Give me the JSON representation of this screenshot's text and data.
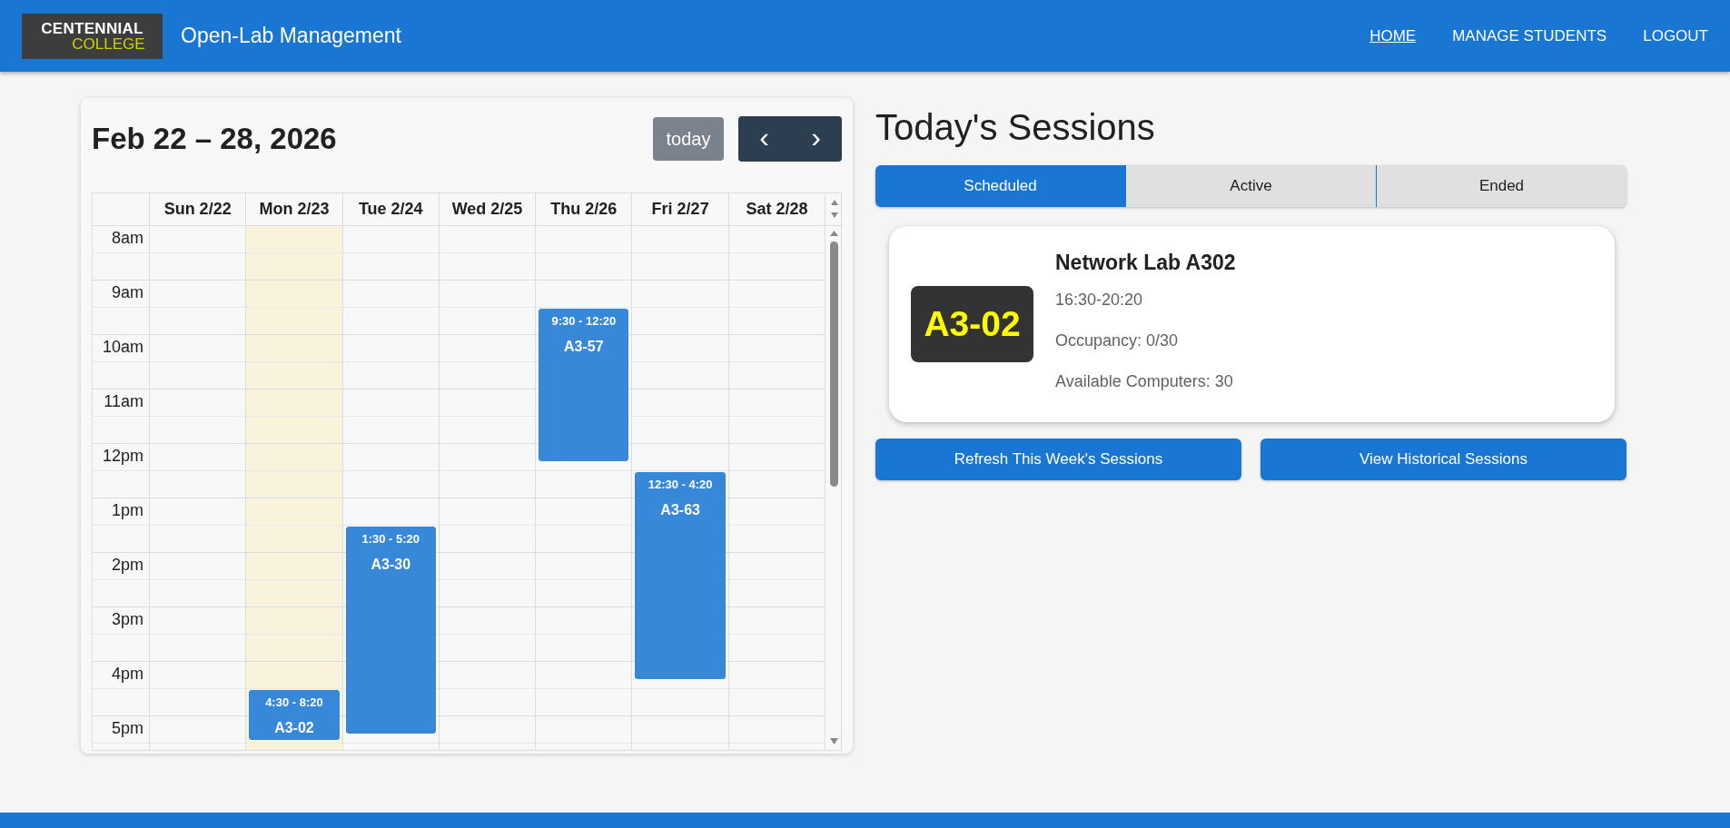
{
  "navbar": {
    "logo": [
      "CENTENNIAL",
      "COLLEGE"
    ],
    "title": "Open-Lab Management",
    "links": [
      {
        "label": "HOME",
        "selected": true
      },
      {
        "label": "MANAGE STUDENTS",
        "selected": false
      },
      {
        "label": "LOGOUT",
        "selected": false
      }
    ]
  },
  "calendar": {
    "title": "Feb 22 – 28, 2026",
    "today_button": "today",
    "prev_button": "‹",
    "next_button": "›",
    "days": [
      {
        "label": "Sun 2/22",
        "today": false
      },
      {
        "label": "Mon 2/23",
        "today": true,
        "events": [
          {
            "time": "4:30 - 8:20",
            "room": "A3-02"
          }
        ]
      },
      {
        "label": "Tue 2/24",
        "today": false,
        "events": [
          {
            "time": "1:30 - 5:20",
            "room": "A3-30"
          }
        ]
      },
      {
        "label": "Wed 2/25",
        "today": false
      },
      {
        "label": "Thu 2/26",
        "today": false,
        "events": [
          {
            "time": "9:30 - 12:20",
            "room": "A3-57"
          }
        ]
      },
      {
        "label": "Fri 2/27",
        "today": false,
        "events": [
          {
            "time": "12:30 - 4:20",
            "room": "A3-63"
          }
        ]
      },
      {
        "label": "Sat 2/28",
        "today": false
      }
    ],
    "hours": [
      "8am",
      "9am",
      "10am",
      "11am",
      "12pm",
      "1pm",
      "2pm",
      "3pm",
      "4pm",
      "5pm"
    ]
  },
  "sessions": {
    "heading": "Today's Sessions",
    "tabs": [
      {
        "label": "Scheduled",
        "selected": true
      },
      {
        "label": "Active",
        "selected": false
      },
      {
        "label": "Ended",
        "selected": false
      }
    ],
    "cards": [
      {
        "badge": "A3-02",
        "name": "Network Lab A302",
        "time": "16:30-20:20",
        "occupancy": "Occupancy: 0/30",
        "available": "Available Computers: 30"
      }
    ],
    "buttons": [
      "Refresh This Week's Sessions",
      "View Historical Sessions"
    ]
  }
}
